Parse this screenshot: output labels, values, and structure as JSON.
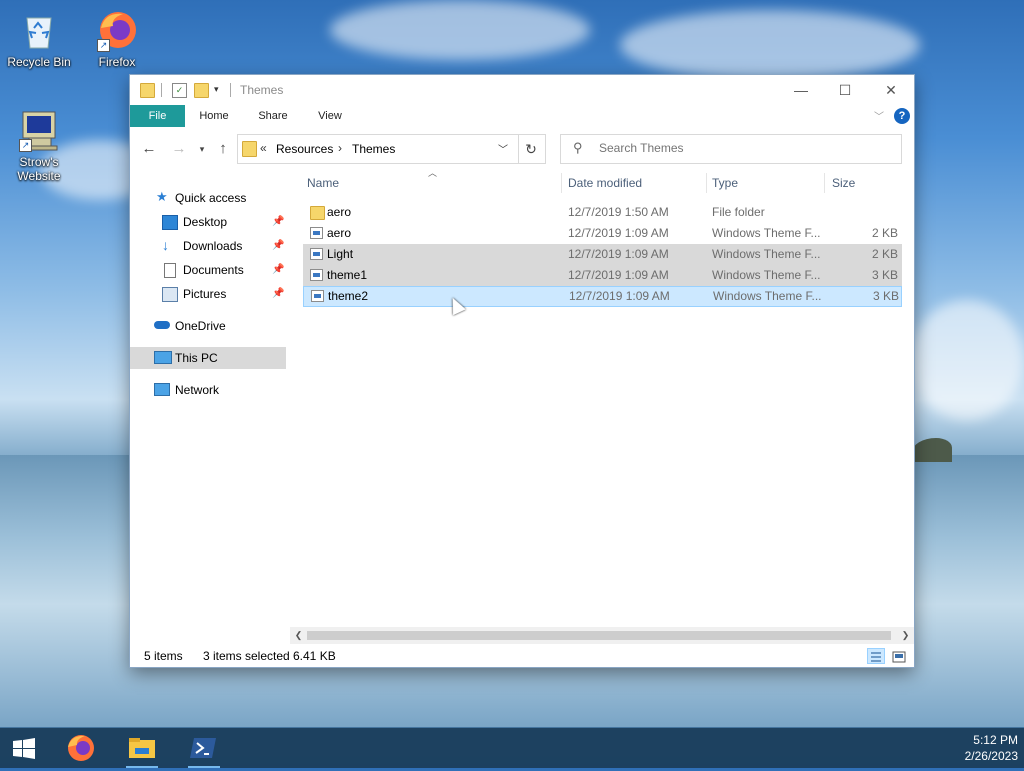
{
  "desktop": {
    "icons": [
      {
        "label": "Recycle Bin",
        "icon": "recycle-bin-icon"
      },
      {
        "label": "Firefox",
        "icon": "firefox-icon"
      },
      {
        "label": "Strow's Website",
        "icon": "computer-icon"
      }
    ]
  },
  "window": {
    "title": "Themes",
    "ribbon_tabs": [
      "File",
      "Home",
      "Share",
      "View"
    ],
    "address": {
      "overflow": "«",
      "crumbs": [
        "Resources",
        "Themes"
      ],
      "separator": "›"
    },
    "search": {
      "placeholder": "Search Themes"
    },
    "nav_pane": {
      "quick_access": "Quick access",
      "pinned": [
        "Desktop",
        "Downloads",
        "Documents",
        "Pictures"
      ],
      "onedrive": "OneDrive",
      "this_pc": "This PC",
      "network": "Network"
    },
    "columns": {
      "name": "Name",
      "date": "Date modified",
      "type": "Type",
      "size": "Size"
    },
    "files": [
      {
        "name": "aero",
        "date": "12/7/2019 1:50 AM",
        "type": "File folder",
        "size": "",
        "kind": "folder",
        "state": "normal"
      },
      {
        "name": "aero",
        "date": "12/7/2019 1:09 AM",
        "type": "Windows Theme F...",
        "size": "2 KB",
        "kind": "theme",
        "state": "normal"
      },
      {
        "name": "Light",
        "date": "12/7/2019 1:09 AM",
        "type": "Windows Theme F...",
        "size": "2 KB",
        "kind": "theme",
        "state": "selected"
      },
      {
        "name": "theme1",
        "date": "12/7/2019 1:09 AM",
        "type": "Windows Theme F...",
        "size": "3 KB",
        "kind": "theme",
        "state": "selected"
      },
      {
        "name": "theme2",
        "date": "12/7/2019 1:09 AM",
        "type": "Windows Theme F...",
        "size": "3 KB",
        "kind": "theme",
        "state": "focused"
      }
    ],
    "status": {
      "items": "5 items",
      "selected": "3 items selected",
      "size": "6.41 KB"
    }
  },
  "taskbar": {
    "apps": [
      "start-icon",
      "firefox-icon",
      "file-explorer-icon",
      "powershell-icon"
    ],
    "time": "5:12 PM",
    "date": "2/26/2023"
  },
  "colors": {
    "file_tab": "#1e9a9a",
    "selection": "#cce8ff",
    "selection_inactive": "#d9d9d9",
    "taskbar": "#183a58"
  }
}
